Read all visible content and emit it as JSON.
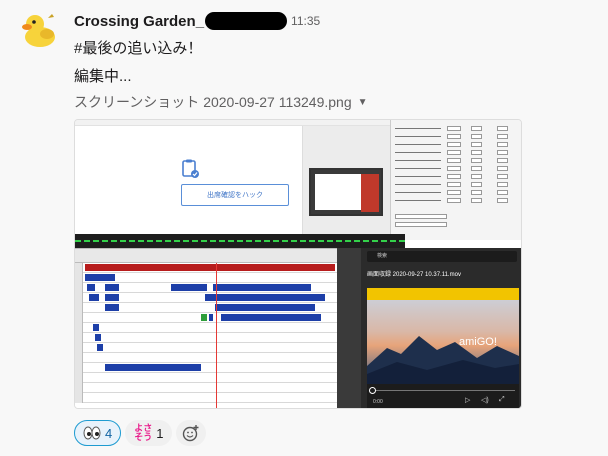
{
  "message": {
    "sender": "Crossing Garden_",
    "time": "11:35",
    "lines": [
      "#最後の追い込み！",
      "編集中..."
    ],
    "attachment": {
      "filename": "スクリーンショット 2020-09-27 113249.png"
    }
  },
  "screenshot": {
    "hack_button": "出席確認をハック",
    "player_search": "検索",
    "player_title": "画面収録 2020-09-27 10.37.11.mov",
    "player_time": "0:00",
    "player_watermark": "amiGO!"
  },
  "reactions": [
    {
      "emoji_name": "eyes-emoji",
      "count": "4",
      "mine": true
    },
    {
      "emoji_name": "yosasou-emoji",
      "emoji_text": "よさそう",
      "count": "1",
      "mine": false
    }
  ],
  "colors": {
    "accent": "#1264a3",
    "clip_blue": "#1d3fa8",
    "clip_red": "#b71c1c",
    "wave_green": "#33d14a"
  }
}
